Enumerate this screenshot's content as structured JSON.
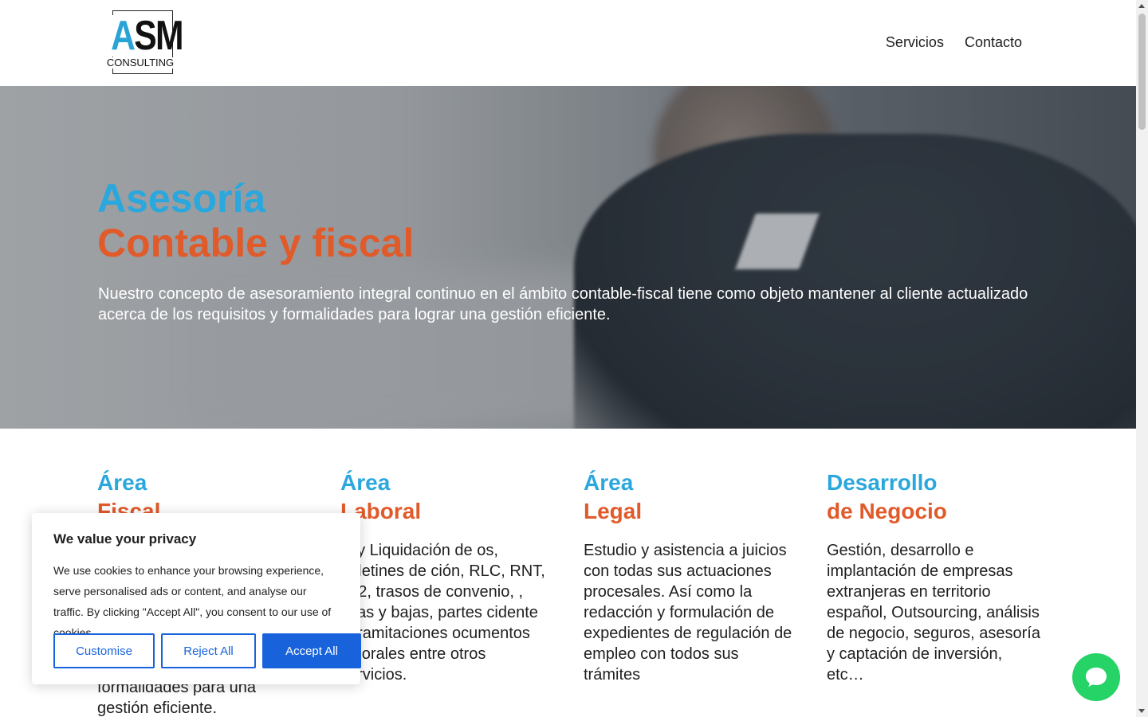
{
  "header": {
    "logo": {
      "letters": "ASM",
      "sub": "CONSULTING"
    },
    "nav": [
      {
        "label": "Servicios"
      },
      {
        "label": "Contacto"
      }
    ]
  },
  "hero": {
    "title_line1": "Asesoría",
    "title_line2": "Contable y fiscal",
    "description": "Nuestro concepto de asesoramiento integral continuo en el ámbito contable-fiscal tiene como objeto mantener al cliente actualizado acerca de los requisitos y formalidades para lograr una gestión eficiente."
  },
  "services": [
    {
      "title_blue": "Área",
      "title_orange": "Fiscal",
      "text": "formalidades para una gestión eficiente."
    },
    {
      "title_blue": "Área",
      "title_orange": "Laboral",
      "text": "lo y Liquidación de os, boletines de ción, RLC, RNT, L02, trasos de convenio, , altas y bajas, partes cidente y tramitaciones ocumentos laborales entre otros servicios."
    },
    {
      "title_blue": "Área",
      "title_orange": "Legal",
      "text": "Estudio y asistencia a juicios con todas sus actuaciones procesales. Así como la redacción y formulación de expedientes de regulación de empleo con todos sus trámites"
    },
    {
      "title_blue": "Desarrollo",
      "title_orange": "de Negocio",
      "text": "Gestión, desarrollo e implantación de empresas extranjeras en territorio español, Outsourcing, análisis de negocio, seguros, asesoría y captación de inversión, etc…"
    }
  ],
  "cookie": {
    "title": "We value your privacy",
    "text": "We use cookies to enhance your browsing experience, serve personalised ads or content, and analyse our traffic. By clicking \"Accept All\", you consent to our use of cookies.",
    "customise_label": "Customise",
    "reject_label": "Reject All",
    "accept_label": "Accept All",
    "accent_color": "#1863dc"
  },
  "chat": {
    "icon": "chat-bubble-icon",
    "color": "#25d366"
  },
  "colors": {
    "blue": "#2aa7dc",
    "orange": "#e15a2a"
  }
}
